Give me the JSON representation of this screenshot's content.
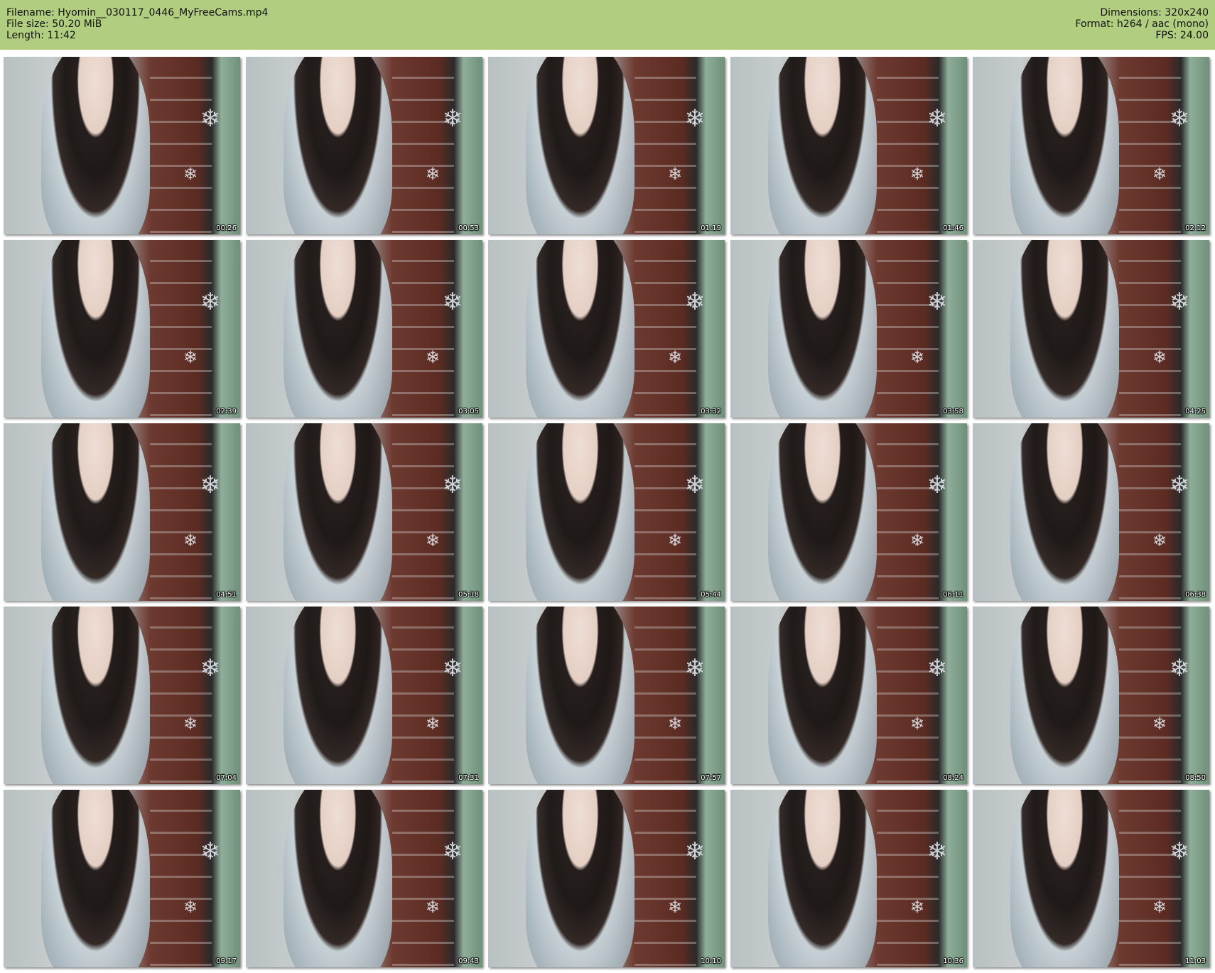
{
  "header": {
    "filename": "Filename: Hyomin__030117_0446_MyFreeCams.mp4",
    "filesize": "File size: 50.20 MiB",
    "length": "Length: 11:42",
    "dimensions": "Dimensions: 320x240",
    "format": "Format: h264 / aac (mono)",
    "fps": "FPS: 24.00"
  },
  "thumbnails": [
    {
      "timestamp": "00:26"
    },
    {
      "timestamp": "00:53"
    },
    {
      "timestamp": "01:19"
    },
    {
      "timestamp": "01:46"
    },
    {
      "timestamp": "02:12"
    },
    {
      "timestamp": "02:39"
    },
    {
      "timestamp": "03:05"
    },
    {
      "timestamp": "03:32"
    },
    {
      "timestamp": "03:58"
    },
    {
      "timestamp": "04:25"
    },
    {
      "timestamp": "04:51"
    },
    {
      "timestamp": "05:18"
    },
    {
      "timestamp": "05:44"
    },
    {
      "timestamp": "06:11"
    },
    {
      "timestamp": "06:38"
    },
    {
      "timestamp": "07:04"
    },
    {
      "timestamp": "07:31"
    },
    {
      "timestamp": "07:57"
    },
    {
      "timestamp": "08:24"
    },
    {
      "timestamp": "08:50"
    },
    {
      "timestamp": "09:17"
    },
    {
      "timestamp": "09:43"
    },
    {
      "timestamp": "10:10"
    },
    {
      "timestamp": "10:36"
    },
    {
      "timestamp": "11:03"
    }
  ],
  "colors": {
    "header_background": "#b1cd7f",
    "page_background": "#ffffff",
    "timestamp_text": "#ffffff"
  }
}
